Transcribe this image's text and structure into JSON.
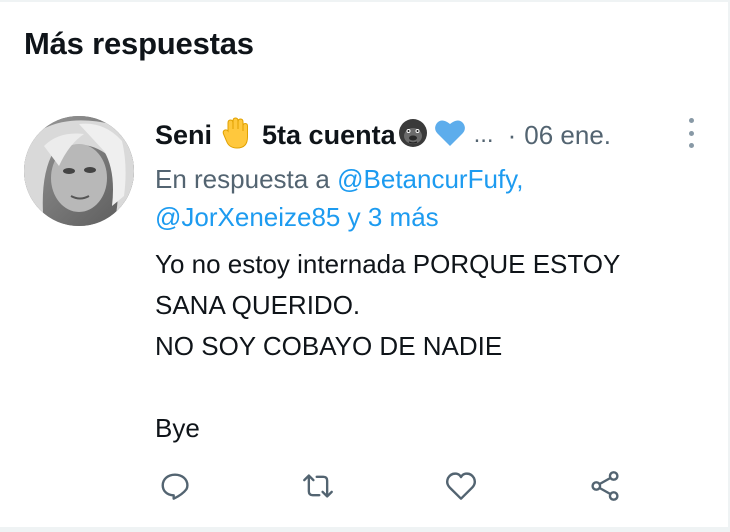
{
  "section": {
    "title": "Más respuestas"
  },
  "tweet": {
    "author_name": "Seni",
    "author_suffix": "5ta cuenta",
    "emojis": [
      "raised-hand-emoji",
      "gorilla-emoji",
      "blue-heart-emoji"
    ],
    "ellipsis": "...",
    "separator": "·",
    "date": "06 ene.",
    "reply_prefix": "En respuesta a",
    "mention_1": "@BetancurFufy,",
    "mention_2": "@JorXeneize85",
    "reply_more": "y 3 más",
    "text": "Yo no estoy internada PORQUE ESTOY\nSANA QUERIDO.\nNO SOY COBAYO DE NADIE\n\nBye"
  },
  "actions": {
    "icons": [
      "reply-icon",
      "retweet-icon",
      "like-icon",
      "share-icon"
    ]
  },
  "colors": {
    "accent": "#1d9bf0",
    "secondary_text": "#536471",
    "primary_text": "#0f1419"
  }
}
